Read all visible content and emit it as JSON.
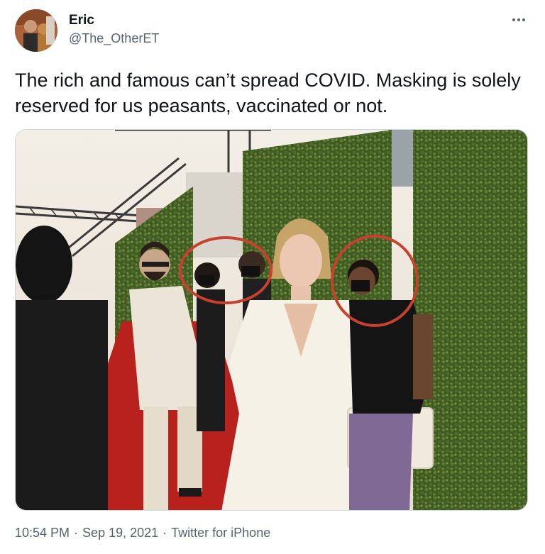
{
  "tweet": {
    "author_name": "Eric",
    "author_handle": "@The_OtherET",
    "text": "The rich and famous can’t spread COVID. Masking is solely reserved for us peasants, vaccinated or not.",
    "time": "10:54 PM",
    "date": "Sep 19, 2021",
    "source": "Twitter for iPhone",
    "separator": "·"
  },
  "icons": {
    "more": "more-horizontal-icon"
  },
  "colors": {
    "text_primary": "#0f1419",
    "text_secondary": "#536471",
    "red_carpet": "#b9221c",
    "annotation_circle": "#c8402e",
    "hedge": "#3f5a22"
  }
}
